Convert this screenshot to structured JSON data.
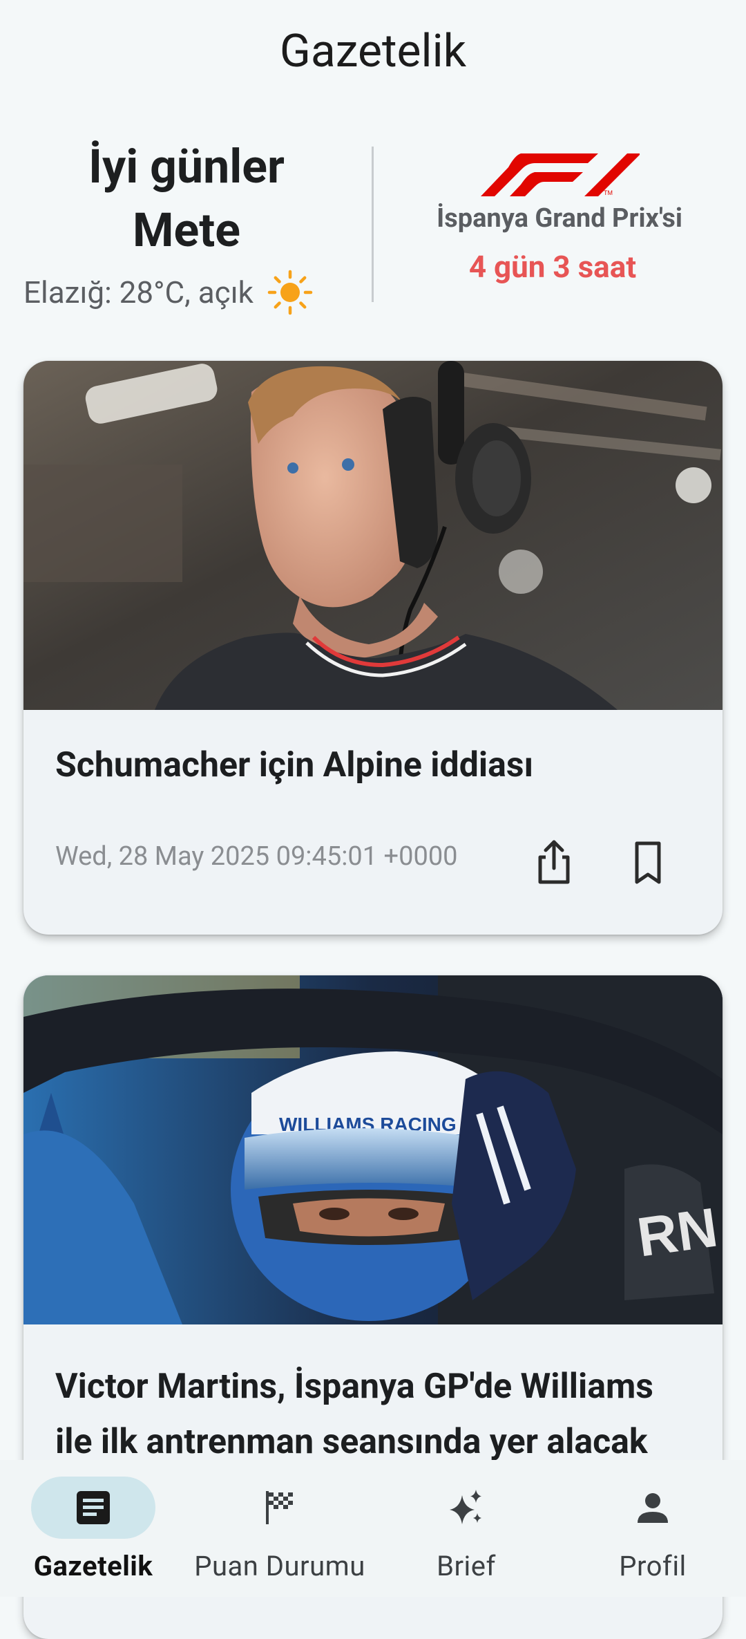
{
  "header": {
    "title": "Gazetelik"
  },
  "greeting": {
    "line1": "İyi günler",
    "line2": "Mete"
  },
  "weather": {
    "text": "Elazığ: 28°C, açık",
    "icon": "sun-icon"
  },
  "race": {
    "logo": "f1-logo",
    "name": "İspanya Grand Prix'si",
    "countdown": "4 gün 3 saat",
    "countdown_color": "#e75555"
  },
  "articles": [
    {
      "title": "Schumacher için Alpine iddiası",
      "date": "Wed, 28 May 2025 09:45:01 +0000"
    },
    {
      "title": "Victor Martins, İspanya GP'de Williams ile ilk antrenman seansında yer alacak"
    }
  ],
  "nav": {
    "items": [
      {
        "label": "Gazetelik",
        "icon": "newspaper-icon",
        "active": true
      },
      {
        "label": "Puan Durumu",
        "icon": "checkered-flag-icon"
      },
      {
        "label": "Brief",
        "icon": "sparkles-icon"
      },
      {
        "label": "Profil",
        "icon": "person-icon"
      }
    ],
    "active_color": "#cfe6ec"
  }
}
